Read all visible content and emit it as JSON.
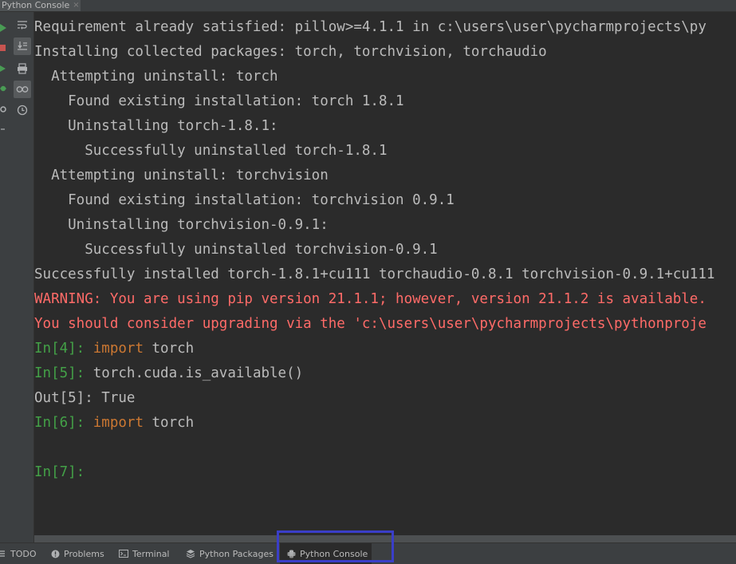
{
  "window": {
    "tab_title": "Python Console",
    "tab_close": "×"
  },
  "console": {
    "lines": [
      {
        "kind": "out",
        "text": "Requirement already satisfied: pillow>=4.1.1 in c:\\users\\user\\pycharmprojects\\py"
      },
      {
        "kind": "out",
        "text": "Installing collected packages: torch, torchvision, torchaudio"
      },
      {
        "kind": "out",
        "text": "  Attempting uninstall: torch"
      },
      {
        "kind": "out",
        "text": "    Found existing installation: torch 1.8.1"
      },
      {
        "kind": "out",
        "text": "    Uninstalling torch-1.8.1:"
      },
      {
        "kind": "out",
        "text": "      Successfully uninstalled torch-1.8.1"
      },
      {
        "kind": "out",
        "text": "  Attempting uninstall: torchvision"
      },
      {
        "kind": "out",
        "text": "    Found existing installation: torchvision 0.9.1"
      },
      {
        "kind": "out",
        "text": "    Uninstalling torchvision-0.9.1:"
      },
      {
        "kind": "out",
        "text": "      Successfully uninstalled torchvision-0.9.1"
      },
      {
        "kind": "out",
        "text": "Successfully installed torch-1.8.1+cu111 torchaudio-0.8.1 torchvision-0.9.1+cu111"
      },
      {
        "kind": "warn",
        "text": "WARNING: You are using pip version 21.1.1; however, version 21.1.2 is available."
      },
      {
        "kind": "warn",
        "text": "You should consider upgrading via the 'c:\\users\\user\\pycharmprojects\\pythonproje"
      }
    ],
    "in4_prompt": "In[4]: ",
    "in4_kw": "import",
    "in4_rest": " torch",
    "in5_prompt": "In[5]: ",
    "in5_code": "torch.cuda.is_available()",
    "out5": "Out[5]: True",
    "in6_prompt": "In[6]: ",
    "in6_kw": "import",
    "in6_rest": " torch",
    "in7_prompt": "In[7]:"
  },
  "bottom_tabs": {
    "todo": "TODO",
    "problems": "Problems",
    "terminal": "Terminal",
    "python_packages": "Python Packages",
    "python_console": "Python Console"
  },
  "colors": {
    "background": "#2b2b2b",
    "panel": "#3c3f41",
    "output_text": "#bbbbbb",
    "warning_text": "#ff6b68",
    "prompt_green": "#43a047",
    "keyword_orange": "#cc7832",
    "highlight_box": "#3a3ec8"
  },
  "icons": {
    "gutter": [
      "run-icon",
      "stop-icon",
      "rerun-icon",
      "debug-icon",
      "settings-icon"
    ],
    "toolbar": [
      "soft-wrap-icon",
      "scroll-to-end-icon",
      "print-icon",
      "show-variables-icon",
      "history-icon"
    ]
  }
}
